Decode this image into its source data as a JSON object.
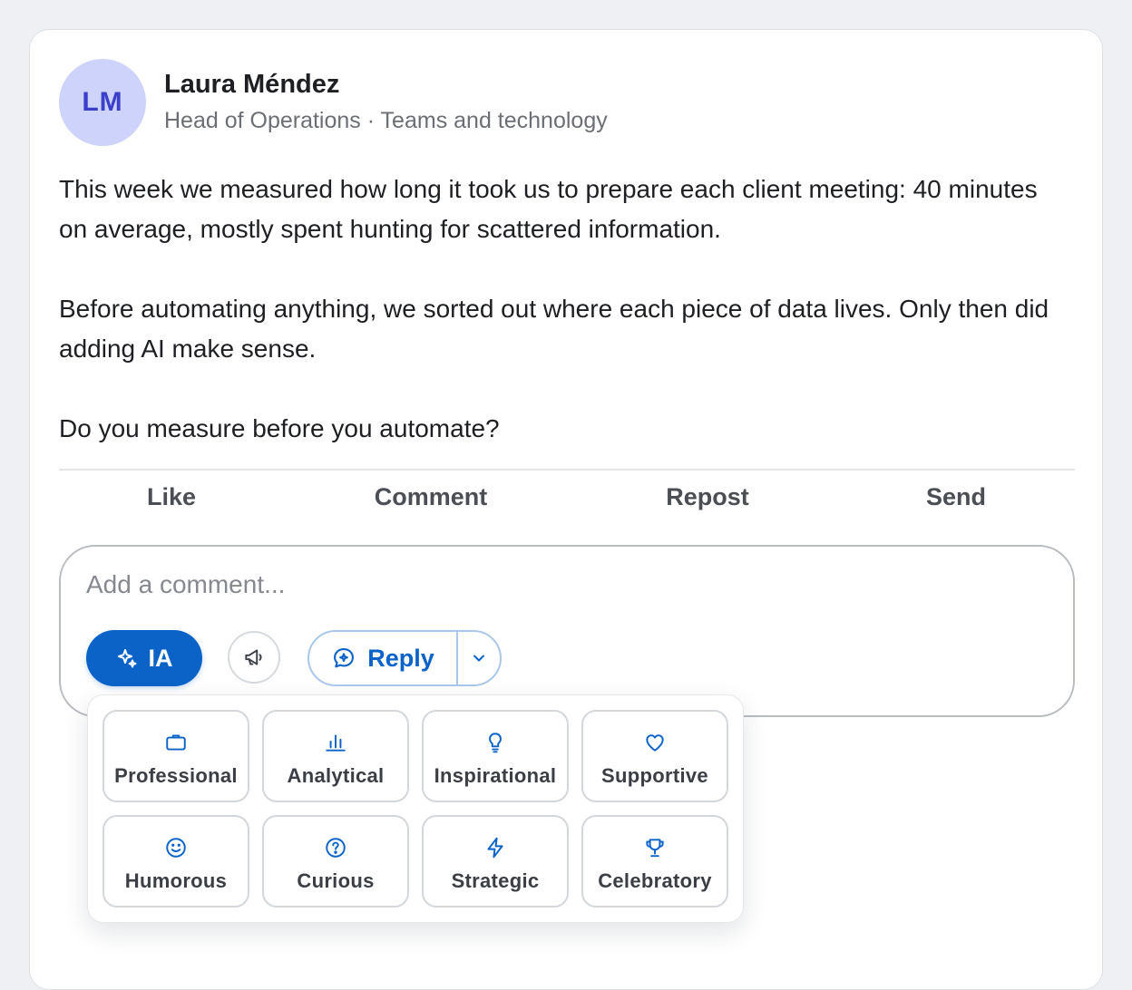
{
  "post": {
    "author": {
      "initials": "LM",
      "name": "Laura Méndez",
      "meta": "Head of Operations · Teams and technology"
    },
    "paragraphs": [
      "This week we measured how long it took us to prepare each client meeting: 40 minutes on average, mostly spent hunting for scattered information.",
      "Before automating anything, we sorted out where each piece of data lives. Only then did adding AI make sense.",
      "Do you measure before you automate?"
    ]
  },
  "actions": {
    "like": "Like",
    "comment": "Comment",
    "repost": "Repost",
    "send": "Send"
  },
  "comment": {
    "placeholder": "Add a comment...",
    "value": "",
    "ia_label": "IA",
    "reply_label": "Reply"
  },
  "tones": [
    {
      "label": "Professional",
      "icon": "briefcase-icon"
    },
    {
      "label": "Analytical",
      "icon": "bar-chart-icon"
    },
    {
      "label": "Inspirational",
      "icon": "lightbulb-icon"
    },
    {
      "label": "Supportive",
      "icon": "heart-icon"
    },
    {
      "label": "Humorous",
      "icon": "smiley-icon"
    },
    {
      "label": "Curious",
      "icon": "question-circle-icon"
    },
    {
      "label": "Strategic",
      "icon": "lightning-icon"
    },
    {
      "label": "Celebratory",
      "icon": "trophy-icon"
    }
  ],
  "colors": {
    "accent": "#0b63c8",
    "avatar_bg": "#cdd3fb",
    "avatar_text": "#3b3fc9",
    "page_bg": "#eff0f3"
  }
}
